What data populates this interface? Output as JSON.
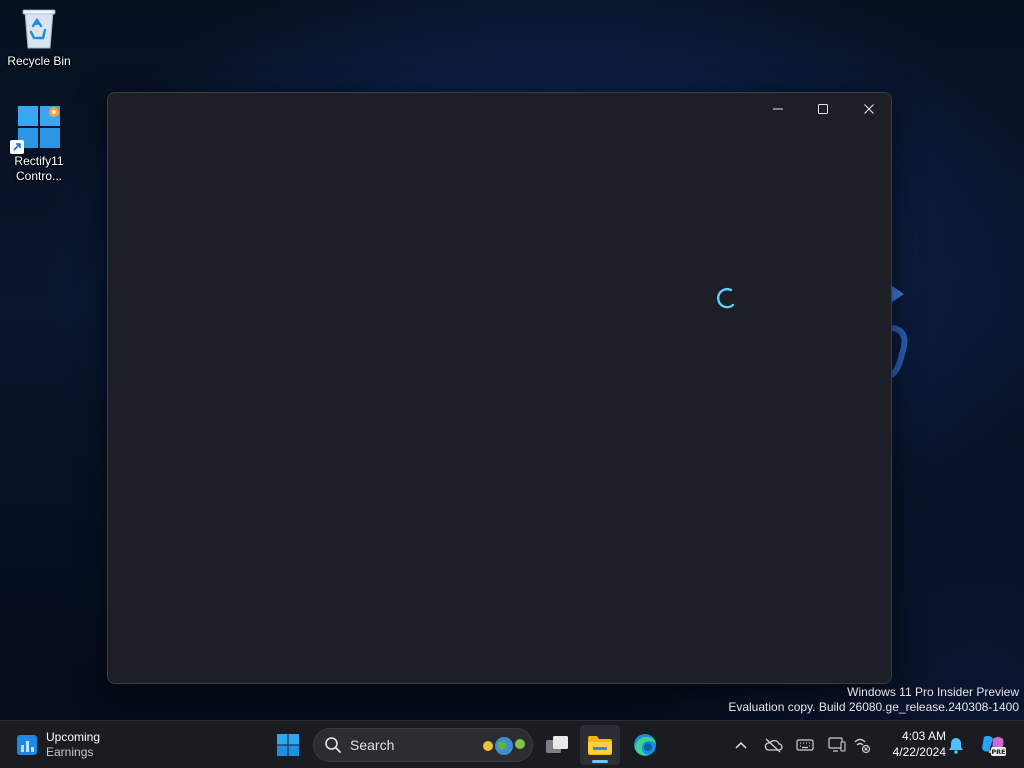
{
  "desktop": {
    "icons": [
      {
        "label": "Recycle Bin"
      },
      {
        "label": "Rectify11 Contro..."
      }
    ]
  },
  "window": {
    "state": "loading",
    "caption": {
      "minimize": "minimize",
      "maximize": "maximize",
      "close": "close"
    }
  },
  "watermark": {
    "line1": "Windows 11 Pro Insider Preview",
    "line2": "Evaluation copy. Build 26080.ge_release.240308-1400"
  },
  "taskbar": {
    "widget": {
      "line1": "Upcoming",
      "line2": "Earnings"
    },
    "search": {
      "label": "Search"
    },
    "apps": [
      "start-icon",
      "task-view-icon",
      "file-explorer-icon",
      "edge-icon"
    ],
    "tray": [
      "chevron-up-icon",
      "cloud-off-icon",
      "keyboard-icon",
      "display-icon",
      "network-off-icon"
    ],
    "clock": {
      "time": "4:03 AM",
      "date": "4/22/2024"
    },
    "copilot_badge": "PRE"
  },
  "colors": {
    "accent": "#60cdff",
    "window_bg": "#1c1f26",
    "taskbar_bg": "#1b1c22"
  }
}
